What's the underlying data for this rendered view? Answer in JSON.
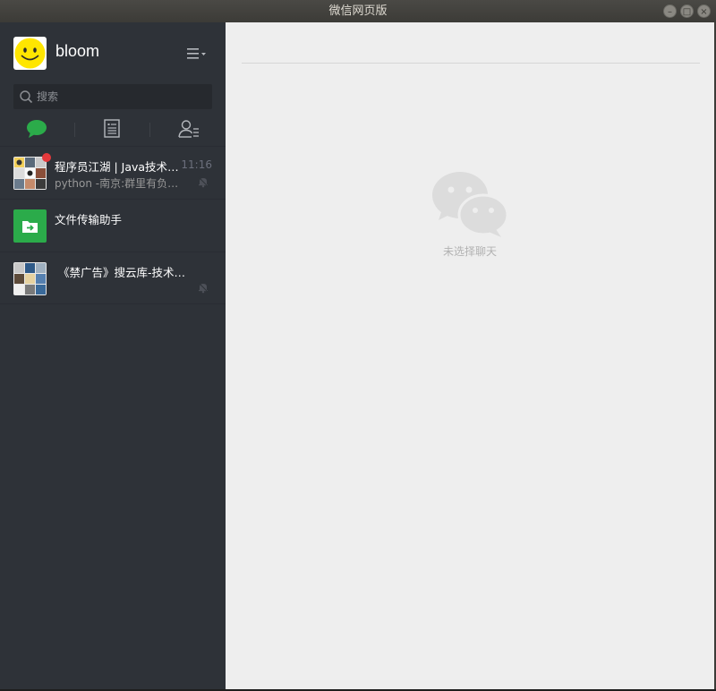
{
  "window": {
    "title": "微信网页版",
    "buttons": [
      "minimize",
      "maximize",
      "close"
    ]
  },
  "profile": {
    "nickname": "bloom",
    "avatar_icon": "smiley-face-icon"
  },
  "search": {
    "placeholder": "搜索"
  },
  "tabs": [
    {
      "name": "chat",
      "icon": "chat-bubble-icon",
      "active": true
    },
    {
      "name": "articles",
      "icon": "document-icon",
      "active": false
    },
    {
      "name": "contacts",
      "icon": "contacts-icon",
      "active": false
    }
  ],
  "chats": [
    {
      "name": "程序员江湖 | Java技术交流群",
      "time": "11:16",
      "last_message": "python -南京:群里有负责人吗",
      "unread_dot": true,
      "muted": true
    },
    {
      "name": "文件传输助手",
      "time": "",
      "last_message": "",
      "unread_dot": false,
      "muted": false
    },
    {
      "name": "《禁广告》搜云库-技术分享交流群",
      "time": "",
      "last_message": "",
      "unread_dot": false,
      "muted": true
    }
  ],
  "main": {
    "empty_text": "未选择聊天"
  },
  "colors": {
    "sidebar_bg": "#2e3238",
    "main_bg": "#eeeeee",
    "accent_green": "#2bab4a",
    "unread_red": "#e4393c"
  }
}
